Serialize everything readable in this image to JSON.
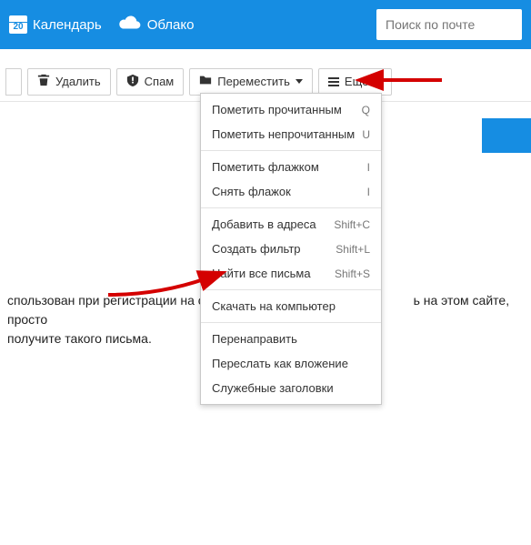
{
  "header": {
    "calendar": {
      "label": "Календарь",
      "day": "20"
    },
    "cloud": {
      "label": "Облако"
    },
    "search_placeholder": "Поиск по почте"
  },
  "toolbar": {
    "prev": "",
    "delete": "Удалить",
    "spam": "Спам",
    "move": "Переместить",
    "more": "Ещё"
  },
  "menu": {
    "groups": [
      [
        {
          "label": "Пометить прочитанным",
          "shortcut": "Q"
        },
        {
          "label": "Пометить непрочитанным",
          "shortcut": "U"
        }
      ],
      [
        {
          "label": "Пометить флажком",
          "shortcut": "I"
        },
        {
          "label": "Снять флажок",
          "shortcut": "I"
        }
      ],
      [
        {
          "label": "Добавить в адреса",
          "shortcut": "Shift+C"
        },
        {
          "label": "Создать фильтр",
          "shortcut": "Shift+L"
        },
        {
          "label": "Найти все письма",
          "shortcut": "Shift+S"
        }
      ],
      [
        {
          "label": "Скачать на компьютер",
          "shortcut": ""
        }
      ],
      [
        {
          "label": "Перенаправить",
          "shortcut": ""
        },
        {
          "label": "Переслать как вложение",
          "shortcut": ""
        },
        {
          "label": "Служебные заголовки",
          "shortcut": ""
        }
      ]
    ]
  },
  "body": {
    "line1_left": "спользован при регистрации на сайт",
    "line1_right": "ь на этом сайте, просто",
    "line2": "получите такого письма."
  }
}
